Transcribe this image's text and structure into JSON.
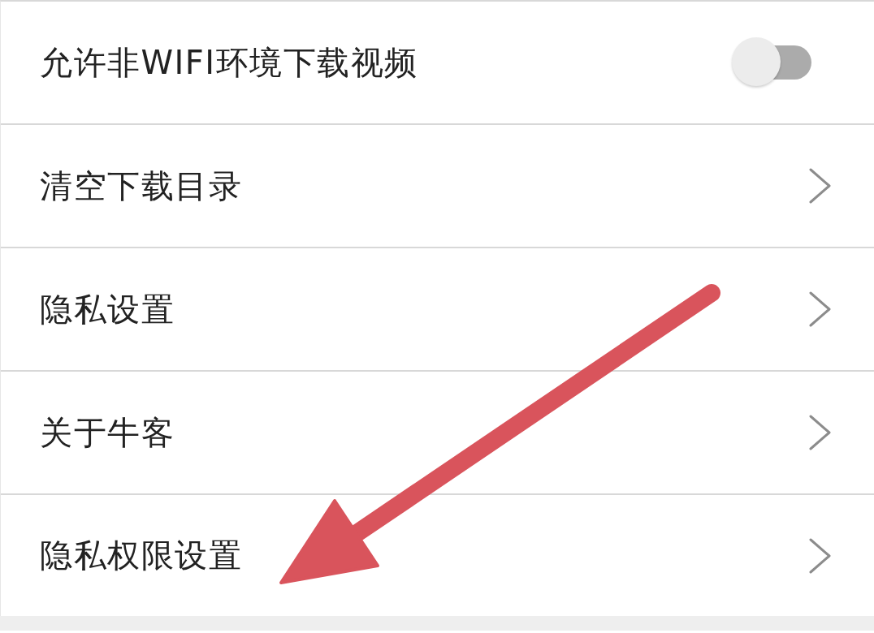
{
  "settings": [
    {
      "kind": "toggle",
      "label": "允许非WIFI环境下载视频",
      "on": false
    },
    {
      "kind": "link",
      "label": "清空下载目录"
    },
    {
      "kind": "link",
      "label": "隐私设置"
    },
    {
      "kind": "link",
      "label": "关于牛客"
    },
    {
      "kind": "link",
      "label": "隐私权限设置"
    }
  ],
  "overlay": {
    "kind": "arrow"
  }
}
